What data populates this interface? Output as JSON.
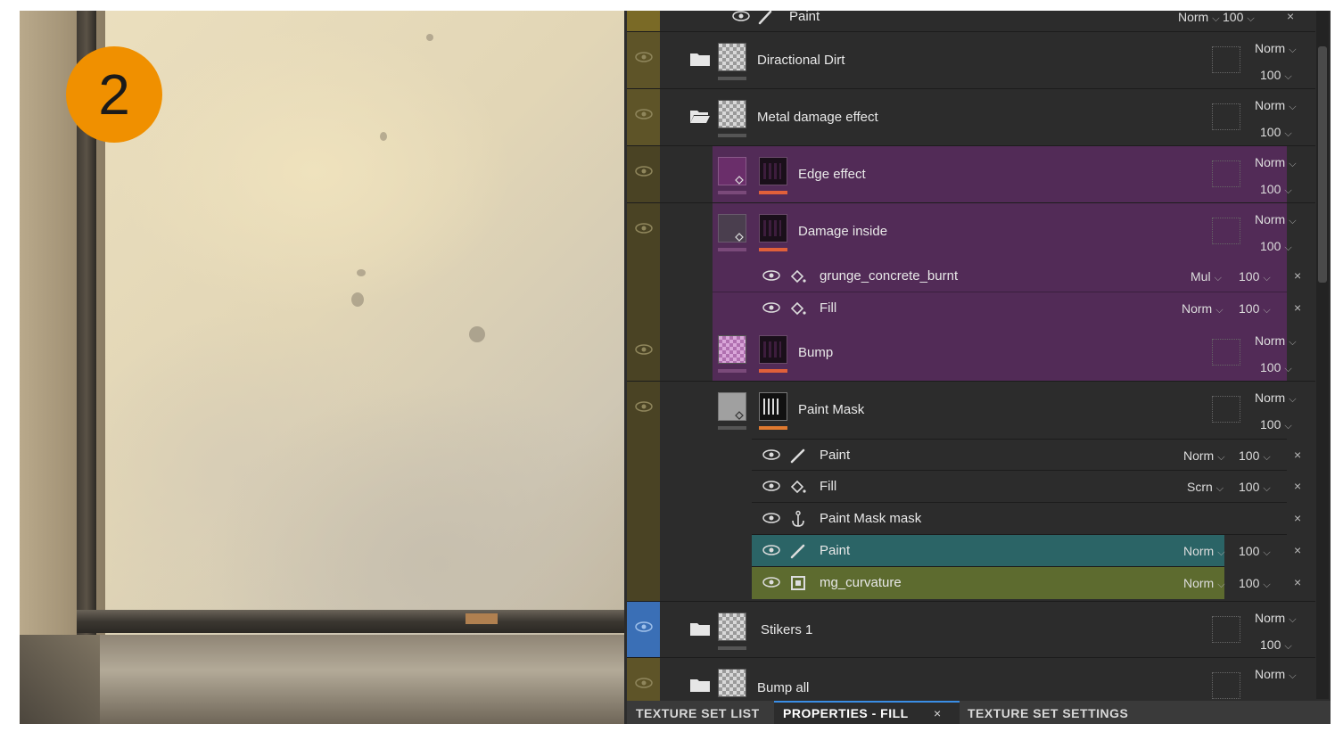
{
  "badge": "2",
  "top_partial_row": {
    "name": "Paint",
    "mode": "Norm",
    "opacity": "100"
  },
  "layers": [
    {
      "name": "Diractional Dirt",
      "mode": "Norm",
      "opacity": "100"
    },
    {
      "name": "Metal damage effect",
      "mode": "Norm",
      "opacity": "100"
    },
    {
      "name": "Edge effect",
      "mode": "Norm",
      "opacity": "100"
    },
    {
      "name": "Damage inside",
      "mode": "Norm",
      "opacity": "100"
    },
    {
      "name": "Bump",
      "mode": "Norm",
      "opacity": "100"
    },
    {
      "name": "Paint Mask",
      "mode": "Norm",
      "opacity": "100"
    },
    {
      "name": "Stikers 1",
      "mode": "Norm",
      "opacity": "100"
    },
    {
      "name": "Bump all",
      "mode": "Norm"
    }
  ],
  "damage_effects": [
    {
      "name": "grunge_concrete_burnt",
      "mode": "Mul",
      "opacity": "100"
    },
    {
      "name": "Fill",
      "mode": "Norm",
      "opacity": "100"
    }
  ],
  "paint_mask_effects": [
    {
      "name": "Paint",
      "mode": "Norm",
      "opacity": "100"
    },
    {
      "name": "Fill",
      "mode": "Scrn",
      "opacity": "100"
    },
    {
      "name": "Paint Mask mask"
    },
    {
      "name": "Paint",
      "mode": "Norm",
      "opacity": "100"
    },
    {
      "name": "mg_curvature",
      "mode": "Norm",
      "opacity": "100"
    }
  ],
  "close_glyph": "×",
  "tabs": [
    "TEXTURE SET LIST",
    "PROPERTIES - FILL",
    "TEXTURE SET SETTINGS"
  ],
  "colors": {
    "badge": "#f09000",
    "purple": "#522b57",
    "teal": "#2b6466",
    "olive": "#5d6b2f",
    "selected_eye": "#3a6fb6"
  }
}
